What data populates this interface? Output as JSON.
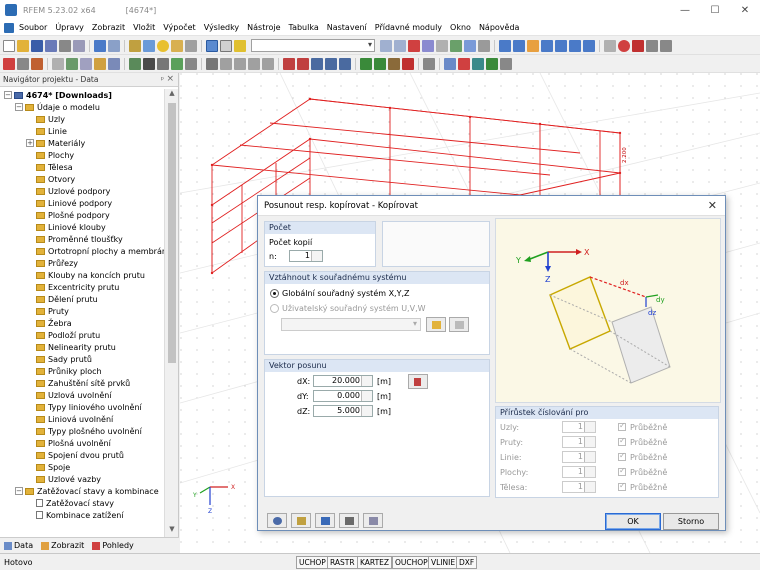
{
  "window": {
    "app_title": "RFEM 5.23.02 x64",
    "doc_title": "[4674*]"
  },
  "menu": [
    "Soubor",
    "Úpravy",
    "Zobrazit",
    "Vložit",
    "Výpočet",
    "Výsledky",
    "Nástroje",
    "Tabulka",
    "Nastavení",
    "Přídavné moduly",
    "Okno",
    "Nápověda"
  ],
  "navigator": {
    "title": "Navigátor projektu - Data",
    "tabs": [
      "Data",
      "Zobrazit",
      "Pohledy"
    ],
    "tree": [
      {
        "label": "4674* [Downloads]",
        "level": 0,
        "kind": "root",
        "exp": "-"
      },
      {
        "label": "Údaje o modelu",
        "level": 1,
        "kind": "folder",
        "exp": "-"
      },
      {
        "label": "Uzly",
        "level": 2,
        "kind": "folder"
      },
      {
        "label": "Linie",
        "level": 2,
        "kind": "folder"
      },
      {
        "label": "Materiály",
        "level": 2,
        "kind": "folder",
        "exp": "+"
      },
      {
        "label": "Plochy",
        "level": 2,
        "kind": "folder"
      },
      {
        "label": "Tělesa",
        "level": 2,
        "kind": "folder"
      },
      {
        "label": "Otvory",
        "level": 2,
        "kind": "folder"
      },
      {
        "label": "Uzlové podpory",
        "level": 2,
        "kind": "folder"
      },
      {
        "label": "Liniové podpory",
        "level": 2,
        "kind": "folder"
      },
      {
        "label": "Plošné podpory",
        "level": 2,
        "kind": "folder"
      },
      {
        "label": "Liniové klouby",
        "level": 2,
        "kind": "folder"
      },
      {
        "label": "Proměnné tloušťky",
        "level": 2,
        "kind": "folder"
      },
      {
        "label": "Ortotropní plochy a membrány",
        "level": 2,
        "kind": "folder"
      },
      {
        "label": "Průřezy",
        "level": 2,
        "kind": "folder"
      },
      {
        "label": "Klouby na koncích prutu",
        "level": 2,
        "kind": "folder"
      },
      {
        "label": "Excentricity prutu",
        "level": 2,
        "kind": "folder"
      },
      {
        "label": "Dělení prutu",
        "level": 2,
        "kind": "folder"
      },
      {
        "label": "Pruty",
        "level": 2,
        "kind": "folder"
      },
      {
        "label": "Žebra",
        "level": 2,
        "kind": "folder"
      },
      {
        "label": "Podloží prutu",
        "level": 2,
        "kind": "folder"
      },
      {
        "label": "Nelinearity prutu",
        "level": 2,
        "kind": "folder"
      },
      {
        "label": "Sady prutů",
        "level": 2,
        "kind": "folder"
      },
      {
        "label": "Průniky ploch",
        "level": 2,
        "kind": "folder"
      },
      {
        "label": "Zahuštění sítě prvků",
        "level": 2,
        "kind": "folder"
      },
      {
        "label": "Uzlová uvolnění",
        "level": 2,
        "kind": "folder"
      },
      {
        "label": "Typy liniového uvolnění",
        "level": 2,
        "kind": "folder"
      },
      {
        "label": "Liniová uvolnění",
        "level": 2,
        "kind": "folder"
      },
      {
        "label": "Typy plošného uvolnění",
        "level": 2,
        "kind": "folder"
      },
      {
        "label": "Plošná uvolnění",
        "level": 2,
        "kind": "folder"
      },
      {
        "label": "Spojení dvou prutů",
        "level": 2,
        "kind": "folder"
      },
      {
        "label": "Spoje",
        "level": 2,
        "kind": "folder"
      },
      {
        "label": "Uzlové vazby",
        "level": 2,
        "kind": "folder"
      },
      {
        "label": "Zatěžovací stavy a kombinace",
        "level": 1,
        "kind": "folder",
        "exp": "-"
      },
      {
        "label": "Zatěžovací stavy",
        "level": 2,
        "kind": "doc"
      },
      {
        "label": "Kombinace zatížení",
        "level": 2,
        "kind": "doc"
      }
    ]
  },
  "viewport": {
    "dimension_label": "2.200",
    "axis_x": "X",
    "axis_y": "Y",
    "axis_z": "Z"
  },
  "dialog": {
    "title": "Posunout resp. kopírovat - Kopírovat",
    "count_group": {
      "title": "Počet",
      "label": "Počet kopií",
      "n_label": "n:",
      "n_value": "1"
    },
    "coord_group": {
      "title": "Vztáhnout k souřadnému systému",
      "global_label": "Globální souřadný systém X,Y,Z",
      "user_label": "Uživatelský souřadný systém U,V,W"
    },
    "vector_group": {
      "title": "Vektor posunu",
      "rows": [
        {
          "label": "dX:",
          "value": "20.000",
          "unit": "[m]"
        },
        {
          "label": "dY:",
          "value": "0.000",
          "unit": "[m]"
        },
        {
          "label": "dZ:",
          "value": "5.000",
          "unit": "[m]"
        }
      ]
    },
    "diagram": {
      "x": "X",
      "y": "Y",
      "z": "Z",
      "dx": "dx",
      "dy": "dy",
      "dz": "dz"
    },
    "numbering_group": {
      "title": "Přírůstek číslování pro",
      "rows": [
        {
          "label": "Uzly:",
          "value": "1",
          "check_label": "Průběžně"
        },
        {
          "label": "Pruty:",
          "value": "1",
          "check_label": "Průběžně"
        },
        {
          "label": "Linie:",
          "value": "1",
          "check_label": "Průběžně"
        },
        {
          "label": "Plochy:",
          "value": "1",
          "check_label": "Průběžně"
        },
        {
          "label": "Tělesa:",
          "value": "1",
          "check_label": "Průběžně"
        }
      ]
    },
    "ok_label": "OK",
    "cancel_label": "Storno"
  },
  "status": {
    "ready": "Hotovo",
    "toggles": [
      "UCHOP",
      "RASTR",
      "KARTEZ",
      "OUCHOP",
      "VLINIE",
      "DXF"
    ]
  },
  "colors": {
    "accent": "#2a6ad4",
    "structure": "#e02020",
    "group_header": "#dce6f4"
  }
}
